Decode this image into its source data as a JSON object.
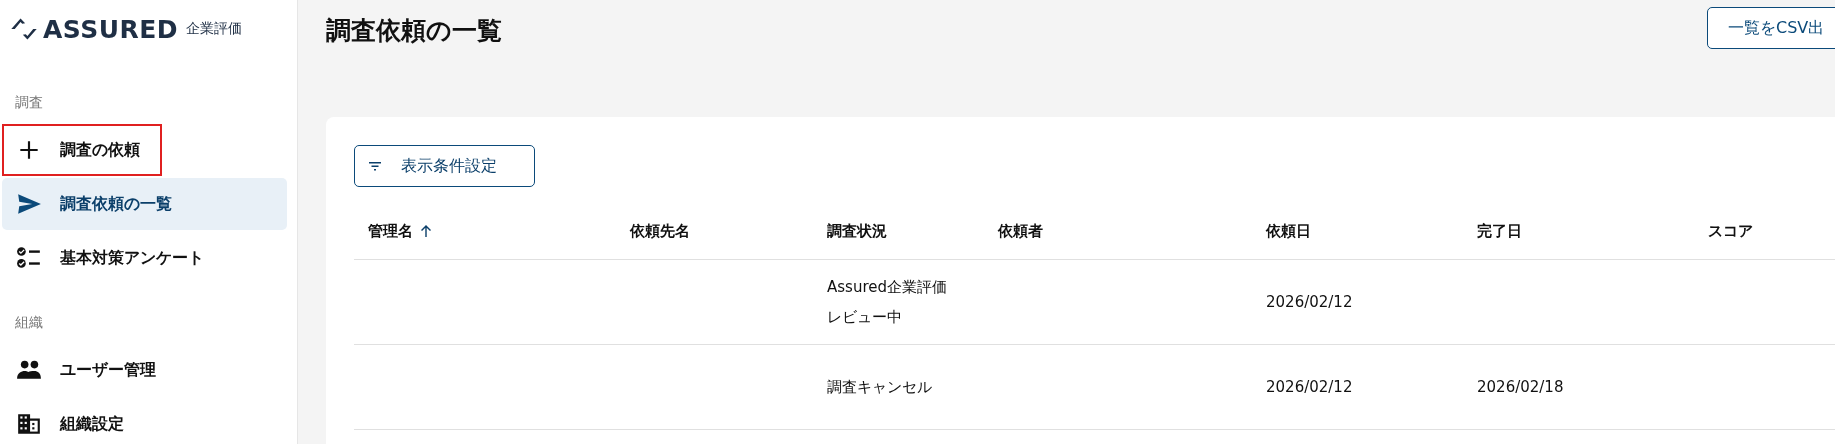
{
  "logo": {
    "wordmark": "ASSURED",
    "subtitle": "企業評価"
  },
  "sidebar": {
    "sections": [
      {
        "label": "調査",
        "items": [
          {
            "label": "調査の依頼",
            "selected": false,
            "highlighted": true
          },
          {
            "label": "調査依頼の一覧",
            "selected": true,
            "highlighted": false
          },
          {
            "label": "基本対策アンケート",
            "selected": false,
            "highlighted": false
          }
        ]
      },
      {
        "label": "組織",
        "items": [
          {
            "label": "ユーザー管理",
            "selected": false,
            "highlighted": false
          },
          {
            "label": "組織設定",
            "selected": false,
            "highlighted": false
          }
        ]
      }
    ]
  },
  "page": {
    "title": "調査依頼の一覧",
    "export_button": "一覧をCSV出"
  },
  "filter_button": "表示条件設定",
  "table": {
    "columns": [
      {
        "label": "管理名",
        "sorted": true
      },
      {
        "label": "依頼先名",
        "sorted": false
      },
      {
        "label": "調査状況",
        "sorted": false
      },
      {
        "label": "依頼者",
        "sorted": false
      },
      {
        "label": "依頼日",
        "sorted": false
      },
      {
        "label": "完了日",
        "sorted": false
      },
      {
        "label": "スコア",
        "sorted": false
      }
    ],
    "rows": [
      {
        "cells": [
          "",
          "",
          [
            "Assured企業評価",
            "レビュー中"
          ],
          "",
          "2026/02/12",
          "",
          ""
        ]
      },
      {
        "cells": [
          "",
          "",
          [
            "調査キャンセル"
          ],
          "",
          "2026/02/12",
          "2026/02/18",
          ""
        ]
      }
    ]
  }
}
